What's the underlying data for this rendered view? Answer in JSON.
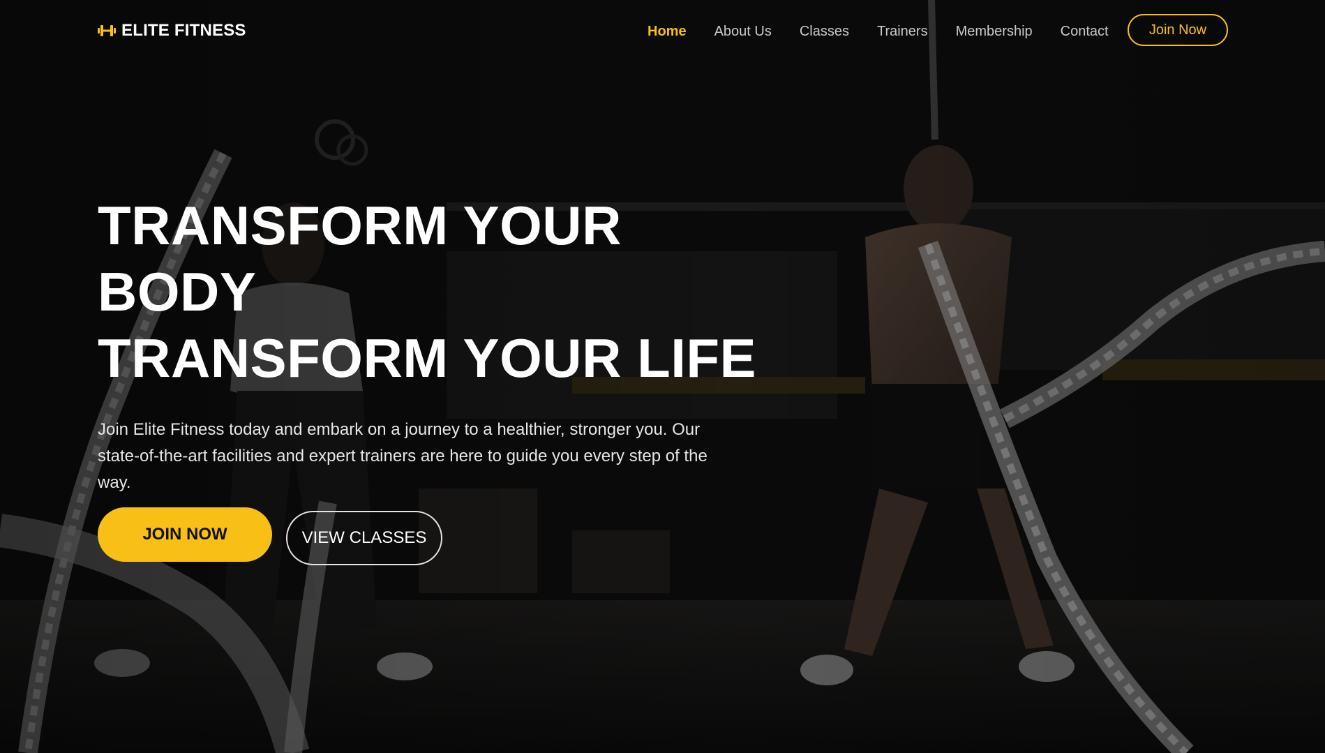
{
  "brand": {
    "name": "ELITE FITNESS",
    "icon": "dumbbell-icon",
    "accent_color": "#f8bf14"
  },
  "nav": {
    "links": [
      {
        "label": "Home",
        "active": true
      },
      {
        "label": "About Us",
        "active": false
      },
      {
        "label": "Classes",
        "active": false
      },
      {
        "label": "Trainers",
        "active": false
      },
      {
        "label": "Membership",
        "active": false
      },
      {
        "label": "Contact",
        "active": false
      }
    ],
    "cta_label": "Join Now"
  },
  "hero": {
    "title_lines": [
      "TRANSFORM YOUR",
      "BODY",
      "TRANSFORM YOUR LIFE"
    ],
    "description": "Join Elite Fitness today and embark on a journey to a healthier, stronger you. Our state-of-the-art facilities and expert trainers are here to guide you every step of the way.",
    "primary_button": "JOIN NOW",
    "secondary_button": "VIEW CLASSES"
  }
}
